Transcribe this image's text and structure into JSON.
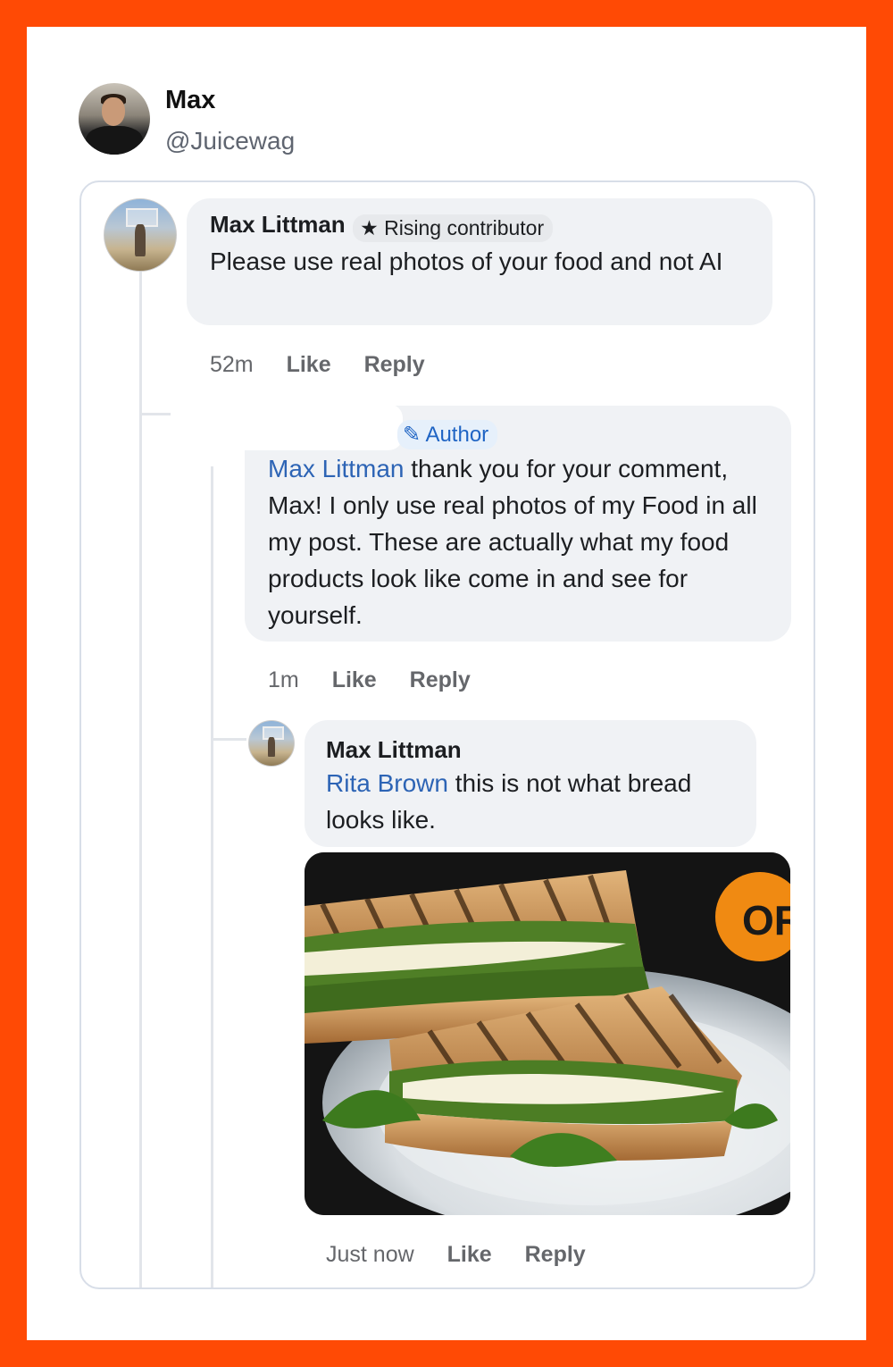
{
  "tweet": {
    "author_name": "Max",
    "author_handle": "@Juicewag"
  },
  "comments": [
    {
      "name": "Max Littman",
      "badge": "Rising contributor",
      "text": "Please use real photos of your food and not AI",
      "time": "52m",
      "like": "Like",
      "reply": "Reply"
    },
    {
      "badge": "Author",
      "mention": "Max Littman",
      "text": "thank you for your comment, Max! I only use real photos of my Food in all my post. These are actually what my food products look like come in and see for yourself.",
      "time": "1m",
      "like": "Like",
      "reply": "Reply"
    },
    {
      "name": "Max Littman",
      "mention": "Rita Brown",
      "text": "this is not what bread looks like.",
      "time": "Just now",
      "like": "Like",
      "reply": "Reply"
    }
  ],
  "photo": {
    "logo_text": "OR"
  },
  "colors": {
    "border": "#ff4a05",
    "mention": "#2d64b5",
    "author_badge": "#1f64c4"
  }
}
